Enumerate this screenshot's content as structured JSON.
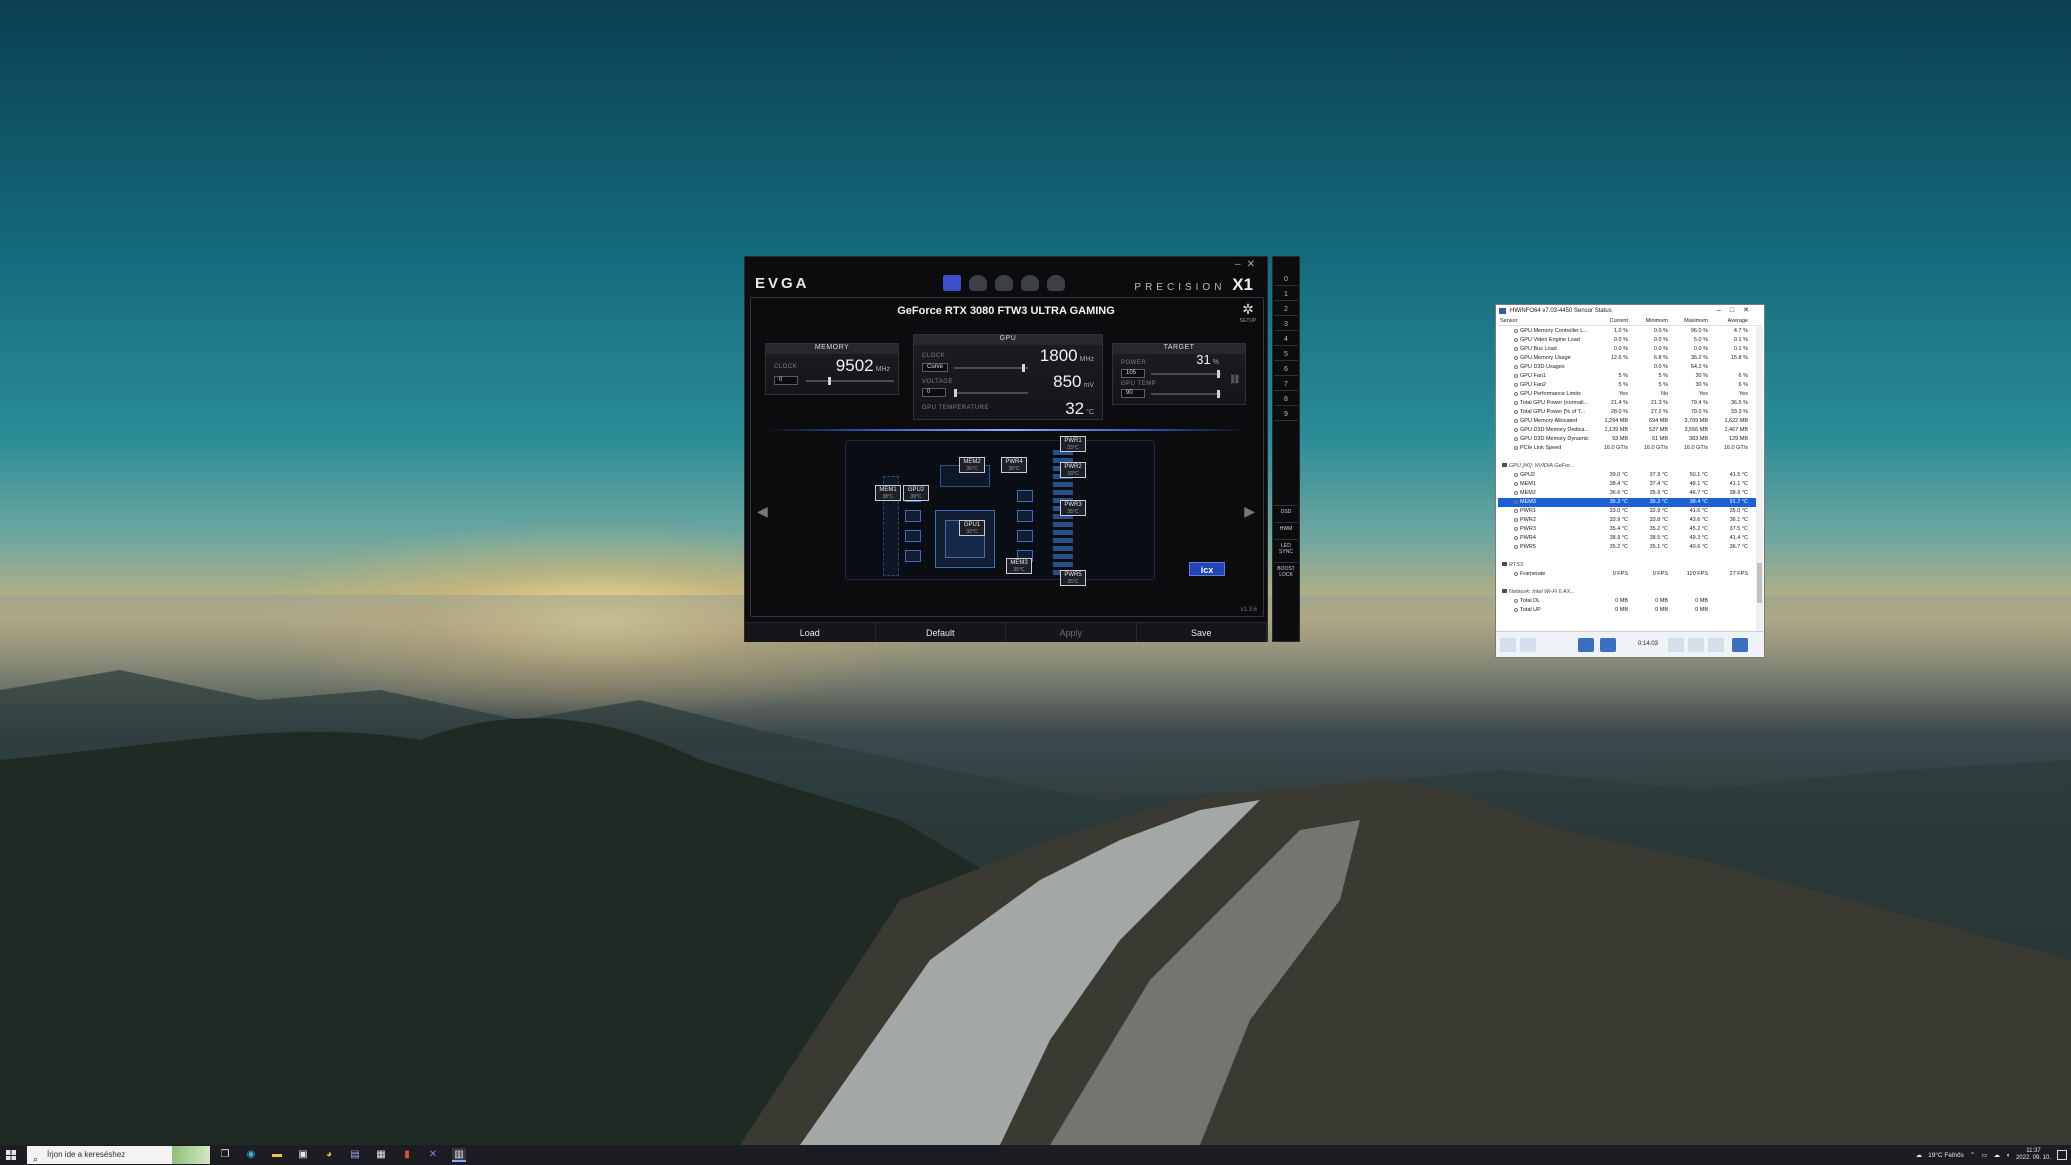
{
  "precision": {
    "logo": "EVGA",
    "brand_prefix": "PRECISION",
    "brand_mark": "X1",
    "setup_label": "SETUP",
    "gpu_title": "GeForce RTX 3080 FTW3 ULTRA GAMING",
    "memory": {
      "header": "MEMORY",
      "clock_label": "CLOCK",
      "clock_value": "9502",
      "clock_unit": "MHz",
      "offset": "0"
    },
    "gpu": {
      "header": "GPU",
      "clock_label": "CLOCK",
      "clock_value": "1800",
      "clock_unit": "MHz",
      "curve_label": "Curve",
      "voltage_label": "VOLTAGE",
      "voltage_value": "850",
      "voltage_unit": "mV",
      "voltage_offset": "0",
      "temp_label": "GPU TEMPERATURE",
      "temp_value": "32",
      "temp_unit": "°C"
    },
    "target": {
      "header": "TARGET",
      "power_label": "POWER",
      "power_value": "31",
      "power_unit": "%",
      "power_target": "105",
      "temp_label": "GPU TEMP",
      "temp_target": "90"
    },
    "sensors": [
      {
        "name": "MEM1",
        "temp": "38°C"
      },
      {
        "name": "GPU2",
        "temp": "39°C"
      },
      {
        "name": "MEM2",
        "temp": "36°C"
      },
      {
        "name": "PWR4",
        "temp": "38°C"
      },
      {
        "name": "PWR1",
        "temp": "33°C"
      },
      {
        "name": "PWR2",
        "temp": "33°C"
      },
      {
        "name": "PWR3",
        "temp": "35°C"
      },
      {
        "name": "GPU1",
        "temp": "32°C"
      },
      {
        "name": "MEM3",
        "temp": "35°C"
      },
      {
        "name": "PWR5",
        "temp": "35°C"
      }
    ],
    "icx_label": "icx",
    "version": "v1.3.6",
    "buttons": {
      "load": "Load",
      "default": "Default",
      "apply": "Apply",
      "save": "Save"
    },
    "profiles": [
      "0",
      "1",
      "2",
      "3",
      "4",
      "5",
      "6",
      "7",
      "8",
      "9"
    ],
    "side_buttons": [
      "OSD",
      "HWM",
      "LED SYNC",
      "BOOST LOCK"
    ]
  },
  "hwinfo": {
    "title": "HWiNFO64 v7.03-4450 Sensor Status",
    "columns": [
      "Sensor",
      "Current",
      "Minimum",
      "Maximum",
      "Average"
    ],
    "rows": [
      [
        "GPU Memory Controller L...",
        "1.0 %",
        "0.0 %",
        "96.0 %",
        "4.7 %"
      ],
      [
        "GPU Video Engine Load",
        "0.0 %",
        "0.0 %",
        "5.0 %",
        "0.1 %"
      ],
      [
        "GPU Bus Load",
        "0.0 %",
        "0.0 %",
        "0.0 %",
        "0.1 %"
      ],
      [
        "GPU Memory Usage",
        "12.6 %",
        "6.8 %",
        "36.2 %",
        "15.8 %"
      ],
      [
        "GPU D3D Usages",
        "",
        "0.0 %",
        "64.2 %",
        ""
      ],
      [
        "GPU Fan1",
        "5 %",
        "5 %",
        "30 %",
        "6 %"
      ],
      [
        "GPU Fan2",
        "5 %",
        "5 %",
        "30 %",
        "6 %"
      ],
      [
        "GPU Performance Limits",
        "Yes",
        "No",
        "Yes",
        "Yes"
      ],
      [
        "Total GPU Power (normali...",
        "21.4 %",
        "21.3 %",
        "79.4 %",
        "36.5 %"
      ],
      [
        "Total GPU Power [% of T...",
        "28.0 %",
        "27.2 %",
        "79.0 %",
        "33.3 %"
      ],
      [
        "GPU Memory Allocated",
        "1,294 MB",
        "694 MB",
        "3,709 MB",
        "1,622 MB"
      ],
      [
        "GPU D3D Memory Dedica...",
        "1,139 MB",
        "537 MB",
        "3,556 MB",
        "1,467 MB"
      ],
      [
        "GPU D3D Memory Dynamic",
        "93 MB",
        "51 MB",
        "383 MB",
        "129 MB"
      ],
      [
        "PCIe Link Speed",
        "16.0 GT/s",
        "16.0 GT/s",
        "16.0 GT/s",
        "16.0 GT/s"
      ]
    ],
    "group_gpu": "GPU [#0]: NVIDIA GeFor...",
    "icx_rows": [
      [
        "GPU2",
        "39.0 °C",
        "37.9 °C",
        "50.1 °C",
        "41.5 °C"
      ],
      [
        "MEM1",
        "38.4 °C",
        "37.4 °C",
        "48.1 °C",
        "41.1 °C"
      ],
      [
        "MEM2",
        "36.6 °C",
        "35.9 °C",
        "46.7 °C",
        "38.9 °C"
      ],
      [
        "MEM3",
        "35.3 °C",
        "35.3 °C",
        "38.4 °C",
        "91.7 °C"
      ],
      [
        "PWR1",
        "33.0 °C",
        "32.9 °C",
        "41.6 °C",
        "35.0 °C"
      ],
      [
        "PWR2",
        "33.9 °C",
        "33.8 °C",
        "43.6 °C",
        "36.1 °C"
      ],
      [
        "PWR3",
        "35.4 °C",
        "35.2 °C",
        "45.2 °C",
        "37.5 °C"
      ],
      [
        "PWR4",
        "38.9 °C",
        "38.5 °C",
        "49.3 °C",
        "41.4 °C"
      ],
      [
        "PWR5",
        "35.2 °C",
        "35.1 °C",
        "40.6 °C",
        "36.7 °C"
      ]
    ],
    "selected_index": 3,
    "group_rtss": "RTSS",
    "rtss_rows": [
      [
        "Framerate",
        "0 FPS",
        "0 FPS",
        "120 FPS",
        "27 FPS"
      ]
    ],
    "group_net": "Network: Intel Wi-Fi 6 AX...",
    "net_rows": [
      [
        "Total DL",
        "0 MB",
        "0 MB",
        "0 MB",
        ""
      ],
      [
        "Total UP",
        "0 MB",
        "0 MB",
        "0 MB",
        ""
      ]
    ],
    "timer": "0:14:03"
  },
  "taskbar": {
    "search_placeholder": "Írjon ide a kereséshez",
    "weather": "19°C Felhős",
    "time": "11:37",
    "date": "2022. 09. 10."
  }
}
